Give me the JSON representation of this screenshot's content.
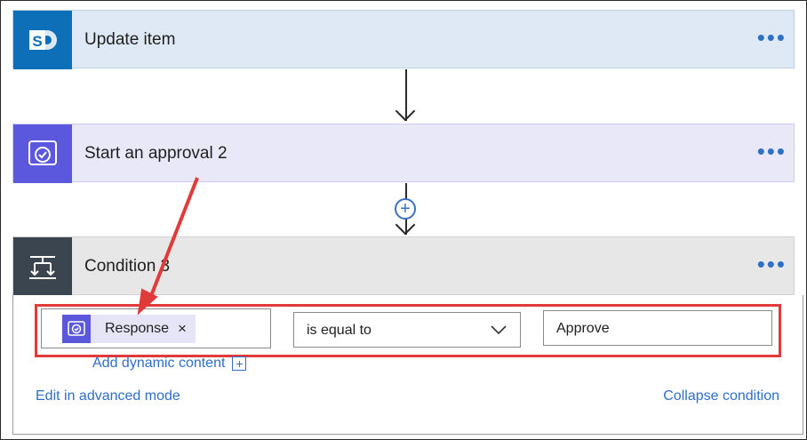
{
  "flow": {
    "steps": [
      {
        "title": "Update item",
        "icon": "sharepoint-icon",
        "more": "•••"
      },
      {
        "title": "Start an approval 2",
        "icon": "approval-icon",
        "more": "•••"
      },
      {
        "title": "Condition 3",
        "icon": "condition-icon",
        "more": "•••"
      }
    ],
    "add_step_symbol": "+"
  },
  "condition": {
    "left_token": {
      "label": "Response",
      "remove": "×",
      "icon": "approval-icon"
    },
    "operator": "is equal to",
    "right_value": "Approve",
    "add_dynamic_content": "Add dynamic content",
    "add_dynamic_symbol": "+",
    "edit_advanced": "Edit in advanced mode",
    "collapse": "Collapse condition"
  },
  "colors": {
    "sharepoint": "#0d6fb8",
    "approval": "#5c58dd",
    "condition": "#3b4550",
    "link": "#2e6fc8",
    "highlight": "#e03a3a"
  }
}
